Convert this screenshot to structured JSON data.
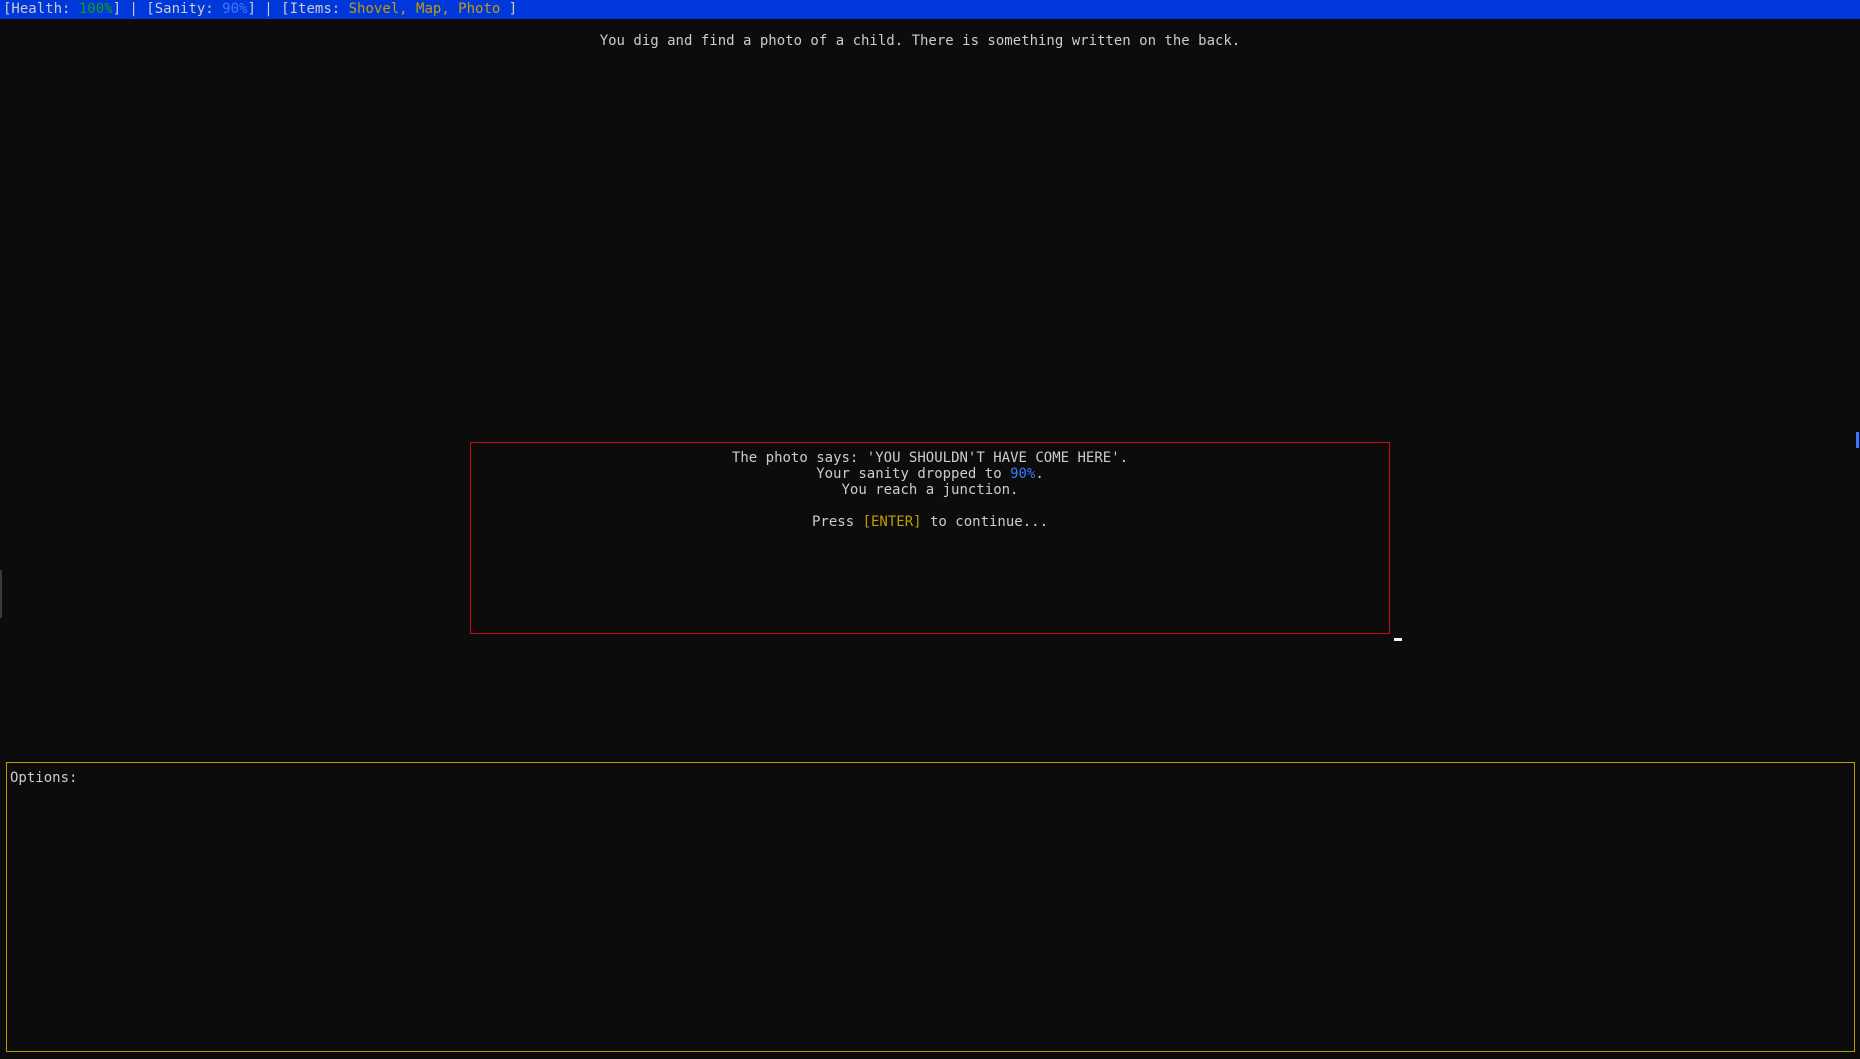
{
  "status_bar": {
    "health_label": "[Health: ",
    "health_value": "100%",
    "health_close": "] | ",
    "sanity_label": "[Sanity: ",
    "sanity_value": "90%",
    "sanity_close": "] | ",
    "items_label": "[Items: ",
    "items_value": "Shovel, Map, Photo",
    "items_close": " ]"
  },
  "narration": "You dig and find a photo of a child. There is something written on the back.",
  "dialog": {
    "line1": "The photo says: 'YOU SHOULDN'T HAVE COME HERE'.",
    "line2_prefix": "Your sanity dropped to ",
    "line2_value": "90%",
    "line2_suffix": ".",
    "line3": "You reach a junction.",
    "prompt_prefix": "Press ",
    "prompt_key": "[ENTER]",
    "prompt_suffix": " to continue..."
  },
  "options": {
    "title": "Options:"
  },
  "colors": {
    "background": "#0c0c0c",
    "status_bar": "#0037da",
    "health": "#13a10e",
    "sanity": "#3b78ff",
    "items": "#c19c00",
    "dialog_border": "#c50f1f",
    "options_border": "#c19c00"
  }
}
